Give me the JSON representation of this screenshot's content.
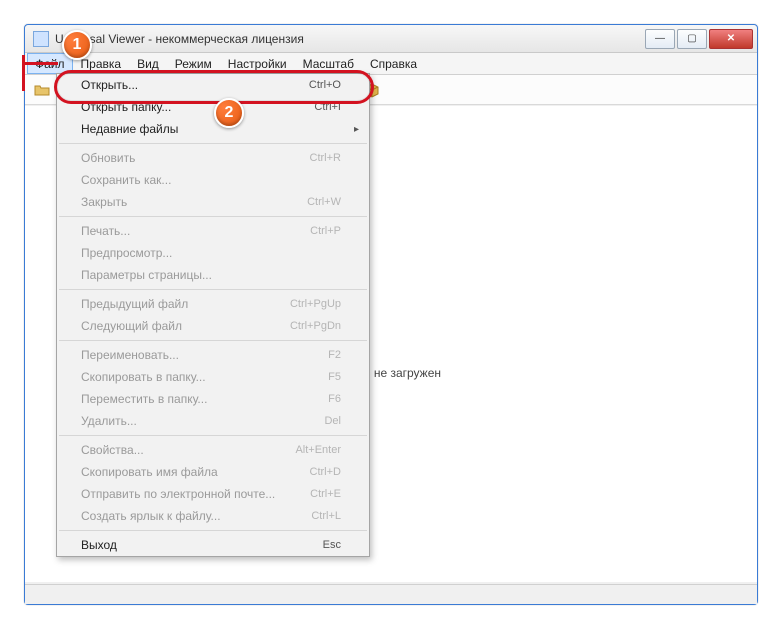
{
  "window": {
    "title": "Universal Viewer - некоммерческая лицензия"
  },
  "menubar": {
    "items": [
      "Файл",
      "Правка",
      "Вид",
      "Режим",
      "Настройки",
      "Масштаб",
      "Справка"
    ]
  },
  "toolbar": {
    "icons": [
      "folder-open-icon",
      "print-icon",
      "copy-icon",
      "nav-prev-icon",
      "nav-next-icon",
      "wrap-icon",
      "fullscreen-icon",
      "zoom-in-icon",
      "zoom-out-icon",
      "one-to-one-icon",
      "tools-icon",
      "package-icon"
    ]
  },
  "canvas": {
    "message": "Файл не загружен"
  },
  "dropdown": {
    "groups": [
      [
        {
          "label": "Открыть...",
          "shortcut": "Ctrl+O",
          "enabled": true,
          "highlight": true
        },
        {
          "label": "Открыть папку...",
          "shortcut": "Ctrl+I",
          "enabled": true
        },
        {
          "label": "Недавние файлы",
          "submenu": true,
          "enabled": true
        }
      ],
      [
        {
          "label": "Обновить",
          "shortcut": "Ctrl+R",
          "enabled": false
        },
        {
          "label": "Сохранить как...",
          "enabled": false
        },
        {
          "label": "Закрыть",
          "shortcut": "Ctrl+W",
          "enabled": false
        }
      ],
      [
        {
          "label": "Печать...",
          "shortcut": "Ctrl+P",
          "enabled": false
        },
        {
          "label": "Предпросмотр...",
          "enabled": false
        },
        {
          "label": "Параметры страницы...",
          "enabled": false
        }
      ],
      [
        {
          "label": "Предыдущий файл",
          "shortcut": "Ctrl+PgUp",
          "enabled": false
        },
        {
          "label": "Следующий файл",
          "shortcut": "Ctrl+PgDn",
          "enabled": false
        }
      ],
      [
        {
          "label": "Переименовать...",
          "shortcut": "F2",
          "enabled": false
        },
        {
          "label": "Скопировать в папку...",
          "shortcut": "F5",
          "enabled": false
        },
        {
          "label": "Переместить в папку...",
          "shortcut": "F6",
          "enabled": false
        },
        {
          "label": "Удалить...",
          "shortcut": "Del",
          "enabled": false
        }
      ],
      [
        {
          "label": "Свойства...",
          "shortcut": "Alt+Enter",
          "enabled": false
        },
        {
          "label": "Скопировать имя файла",
          "shortcut": "Ctrl+D",
          "enabled": false
        },
        {
          "label": "Отправить по электронной почте...",
          "shortcut": "Ctrl+E",
          "enabled": false
        },
        {
          "label": "Создать ярлык к файлу...",
          "shortcut": "Ctrl+L",
          "enabled": false
        }
      ],
      [
        {
          "label": "Выход",
          "shortcut": "Esc",
          "enabled": true
        }
      ]
    ]
  },
  "annotations": {
    "badge1": "1",
    "badge2": "2"
  }
}
